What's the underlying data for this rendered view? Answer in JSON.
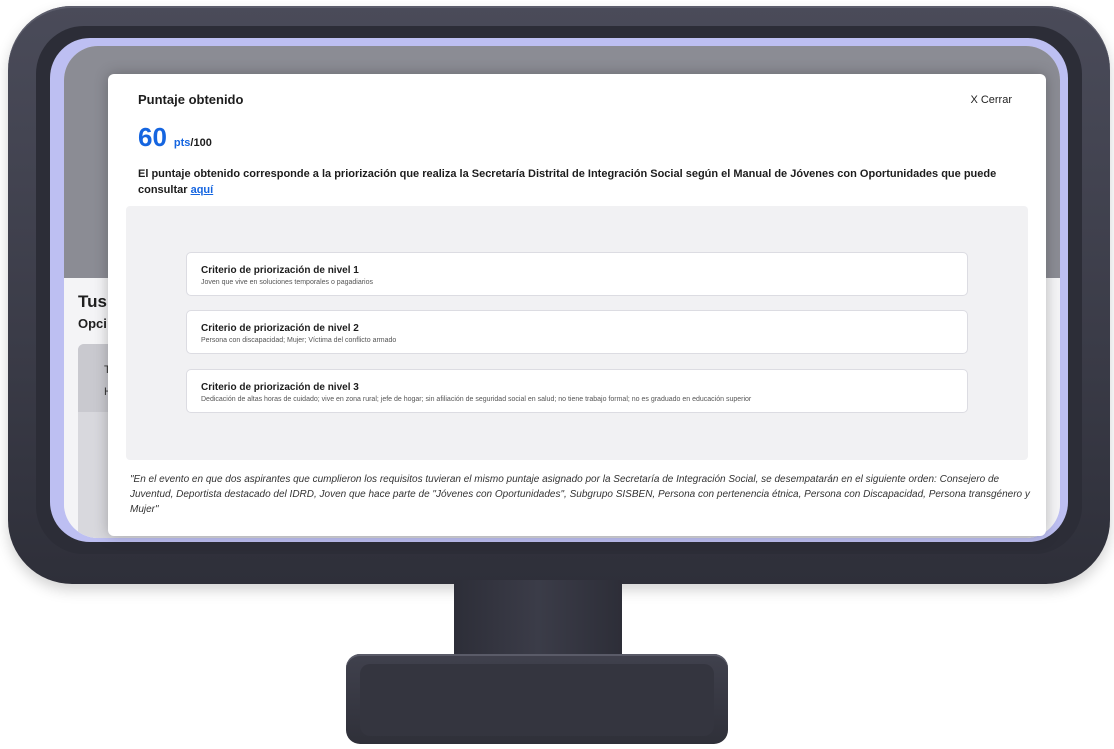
{
  "background_page": {
    "title": "Tus",
    "subtitle": "Opci",
    "card_line1": "T",
    "card_line2": "H"
  },
  "modal": {
    "title": "Puntaje obtenido",
    "close_label": "X Cerrar",
    "score": {
      "value": "60",
      "unit": "pts",
      "total": "/100"
    },
    "description_text": "El puntaje obtenido corresponde a la priorización que realiza la Secretaría Distrital de Integración Social según el Manual de Jóvenes con Oportunidades que puede consultar ",
    "description_link": "aquí",
    "criteria": [
      {
        "title": "Criterio de priorización de nivel 1",
        "description": "Joven que vive en soluciones temporales o pagadiarios"
      },
      {
        "title": "Criterio de priorización de nivel 2",
        "description": "Persona con discapacidad; Mujer; Víctima del conflicto armado"
      },
      {
        "title": "Criterio de priorización de nivel 3",
        "description": "Dedicación de altas horas de cuidado; vive en zona rural; jefe de hogar; sin afiliación de seguridad social en salud; no tiene trabajo formal; no es graduado en educación superior"
      }
    ],
    "footnote": "\"En el evento en que dos aspirantes que cumplieron los requisitos tuvieran el mismo puntaje asignado por la Secretaría de Integración Social, se desempatarán en el siguiente orden: Consejero de Juventud, Deportista destacado del IDRD, Joven que hace parte de \"Jóvenes con Oportunidades\", Subgrupo SISBEN, Persona con pertenencia étnica, Persona con Discapacidad, Persona transgénero y Mujer\""
  },
  "colors": {
    "accent": "#1565e0",
    "screen_glow": "#bdbff2",
    "monitor": "#3a3b47"
  }
}
